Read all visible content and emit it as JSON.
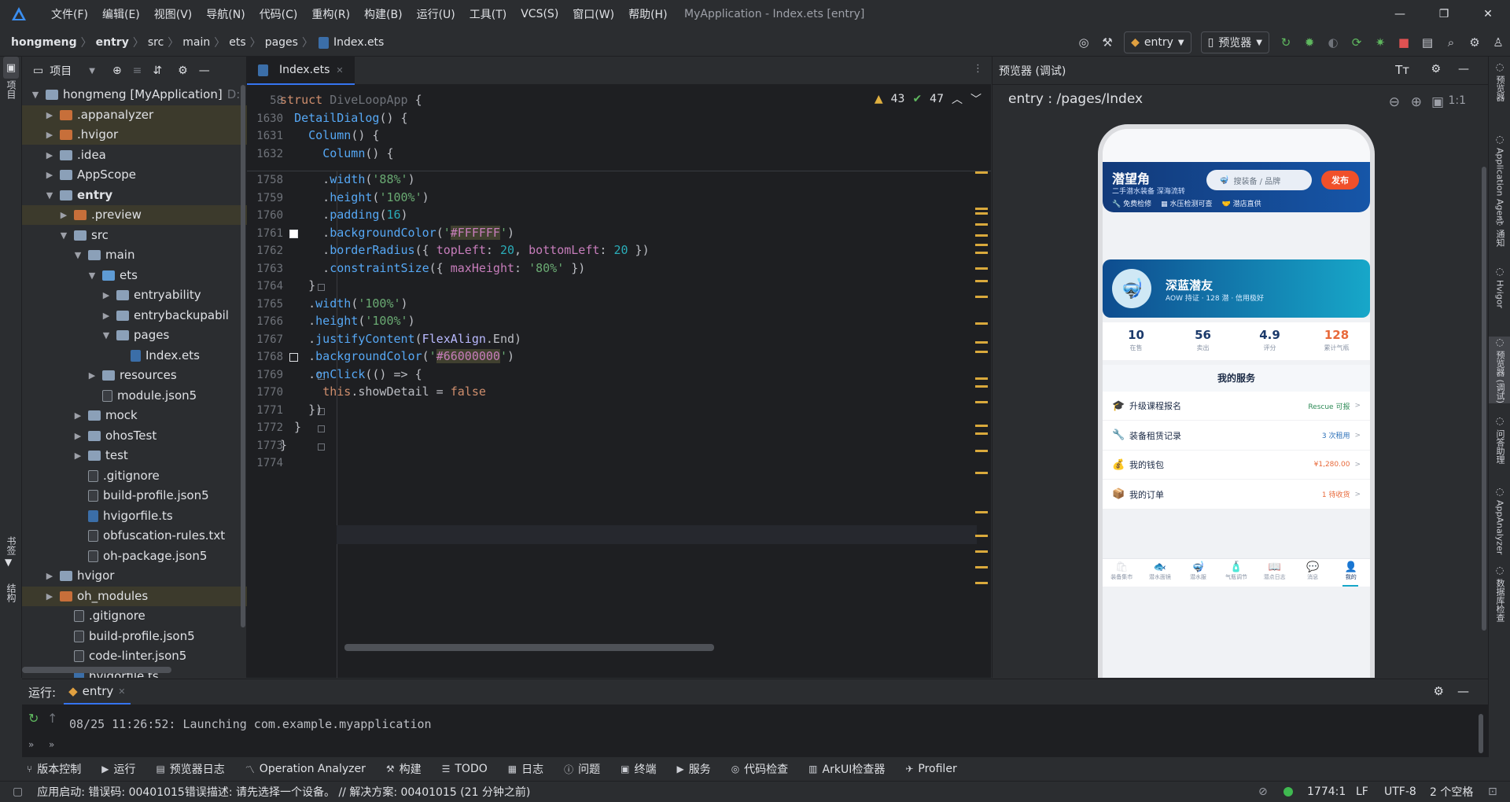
{
  "titlebar": {
    "menus": [
      "文件(F)",
      "编辑(E)",
      "视图(V)",
      "导航(N)",
      "代码(C)",
      "重构(R)",
      "构建(B)",
      "运行(U)",
      "工具(T)",
      "VCS(S)",
      "窗口(W)",
      "帮助(H)"
    ],
    "title": "MyApplication - Index.ets [entry]"
  },
  "navbar": {
    "crumbs": [
      "hongmeng",
      "entry",
      "src",
      "main",
      "ets",
      "pages",
      "Index.ets"
    ],
    "run_config": "entry",
    "device": "预览器"
  },
  "project": {
    "title": "项目",
    "tree": [
      {
        "label": "hongmeng [MyApplication]",
        "suffix": "D:",
        "depth": 0,
        "open": true,
        "kind": "folder"
      },
      {
        "label": ".appanalyzer",
        "depth": 1,
        "kind": "folder-or",
        "hl": true
      },
      {
        "label": ".hvigor",
        "depth": 1,
        "kind": "folder-or",
        "hl": true
      },
      {
        "label": ".idea",
        "depth": 1,
        "kind": "folder"
      },
      {
        "label": "AppScope",
        "depth": 1,
        "kind": "folder"
      },
      {
        "label": "entry",
        "depth": 1,
        "open": true,
        "kind": "folder",
        "bold": true
      },
      {
        "label": ".preview",
        "depth": 2,
        "kind": "folder-or",
        "hl": true
      },
      {
        "label": "src",
        "depth": 2,
        "open": true,
        "kind": "folder"
      },
      {
        "label": "main",
        "depth": 3,
        "open": true,
        "kind": "folder"
      },
      {
        "label": "ets",
        "depth": 4,
        "open": true,
        "kind": "folder-bl"
      },
      {
        "label": "entryability",
        "depth": 5,
        "kind": "folder"
      },
      {
        "label": "entrybackupabil",
        "depth": 5,
        "kind": "folder"
      },
      {
        "label": "pages",
        "depth": 5,
        "open": true,
        "kind": "folder"
      },
      {
        "label": "Index.ets",
        "depth": 6,
        "kind": "file-ts",
        "leaf": true
      },
      {
        "label": "resources",
        "depth": 4,
        "kind": "folder"
      },
      {
        "label": "module.json5",
        "depth": 4,
        "kind": "file",
        "leaf": true
      },
      {
        "label": "mock",
        "depth": 3,
        "kind": "folder"
      },
      {
        "label": "ohosTest",
        "depth": 3,
        "kind": "folder"
      },
      {
        "label": "test",
        "depth": 3,
        "kind": "folder"
      },
      {
        "label": ".gitignore",
        "depth": 3,
        "kind": "file",
        "leaf": true
      },
      {
        "label": "build-profile.json5",
        "depth": 3,
        "kind": "file",
        "leaf": true
      },
      {
        "label": "hvigorfile.ts",
        "depth": 3,
        "kind": "file-ts",
        "leaf": true
      },
      {
        "label": "obfuscation-rules.txt",
        "depth": 3,
        "kind": "file",
        "leaf": true
      },
      {
        "label": "oh-package.json5",
        "depth": 3,
        "kind": "file",
        "leaf": true
      },
      {
        "label": "hvigor",
        "depth": 1,
        "kind": "folder"
      },
      {
        "label": "oh_modules",
        "depth": 1,
        "kind": "folder-or",
        "hl": true
      },
      {
        "label": ".gitignore",
        "depth": 2,
        "kind": "file",
        "leaf": true
      },
      {
        "label": "build-profile.json5",
        "depth": 2,
        "kind": "file",
        "leaf": true
      },
      {
        "label": "code-linter.json5",
        "depth": 2,
        "kind": "file",
        "leaf": true
      },
      {
        "label": "hvigorfile.ts",
        "depth": 2,
        "kind": "file-ts",
        "leaf": true
      }
    ]
  },
  "editor": {
    "tab": "Index.ets",
    "warnings": "43",
    "checks": "47",
    "sticky": [
      {
        "ln": "58",
        "code": "struct DiveLoopApp {"
      },
      {
        "ln": "1630",
        "code": "  DetailDialog() {"
      },
      {
        "ln": "1631",
        "code": "    Column() {"
      },
      {
        "ln": "1632",
        "code": "      Column() {"
      }
    ],
    "lines": [
      {
        "ln": "1758",
        "code": "      .width('88%')"
      },
      {
        "ln": "1759",
        "code": "      .height('100%')"
      },
      {
        "ln": "1760",
        "code": "      .padding(16)"
      },
      {
        "ln": "1761",
        "code": "      .backgroundColor('#FFFFFF')"
      },
      {
        "ln": "1762",
        "code": "      .borderRadius({ topLeft: 20, bottomLeft: 20 })"
      },
      {
        "ln": "1763",
        "code": "      .constraintSize({ maxHeight: '80%' })"
      },
      {
        "ln": "1764",
        "code": "    }"
      },
      {
        "ln": "1765",
        "code": "    .width('100%')"
      },
      {
        "ln": "1766",
        "code": "    .height('100%')"
      },
      {
        "ln": "1767",
        "code": "    .justifyContent(FlexAlign.End)"
      },
      {
        "ln": "1768",
        "code": "    .backgroundColor('#66000000')"
      },
      {
        "ln": "1769",
        "code": "    .onClick(() => {"
      },
      {
        "ln": "1770",
        "code": "      this.showDetail = false"
      },
      {
        "ln": "1771",
        "code": "    })"
      },
      {
        "ln": "1772",
        "code": "  }"
      },
      {
        "ln": "1773",
        "code": "}"
      },
      {
        "ln": "1774",
        "code": ""
      }
    ]
  },
  "preview": {
    "title": "预览器 (调试)",
    "route": "entry : /pages/Index",
    "zoom": "1:1",
    "app": {
      "brand": "潜望角",
      "tagline": "二手潜水装备 深海流转",
      "search_placeholder": "搜装备 / 品牌",
      "publish": "发布",
      "badges": [
        "免费检修",
        "水压检测可查",
        "潜店直供"
      ],
      "profile": {
        "name": "深蓝潜友",
        "desc": "AOW 持证 · 128 潜 · 信用极好"
      },
      "stats": [
        {
          "value": "10",
          "label": "在售",
          "color": "#1b3a6b"
        },
        {
          "value": "56",
          "label": "卖出",
          "color": "#1b3a6b"
        },
        {
          "value": "4.9",
          "label": "评分",
          "color": "#1b3a6b"
        },
        {
          "value": "128",
          "label": "累计气瓶",
          "color": "#e8693a"
        }
      ],
      "services_title": "我的服务",
      "services": [
        {
          "icon": "🎓",
          "label": "升级课程报名",
          "value": "Rescue 可报",
          "color": "#2e8b57"
        },
        {
          "icon": "🔧",
          "label": "装备租赁记录",
          "value": "3 次租用",
          "color": "#2a6fb8"
        },
        {
          "icon": "💰",
          "label": "我的钱包",
          "value": "¥1,280.00",
          "color": "#e8693a"
        },
        {
          "icon": "📦",
          "label": "我的订单",
          "value": "1 待收货",
          "color": "#e8693a"
        }
      ],
      "tabs": [
        {
          "icon": "🛍",
          "label": "装备集市"
        },
        {
          "icon": "🐟",
          "label": "潜水面镜"
        },
        {
          "icon": "🤿",
          "label": "潜水服"
        },
        {
          "icon": "🧴",
          "label": "气瓶调节"
        },
        {
          "icon": "📖",
          "label": "潜点日志"
        },
        {
          "icon": "💬",
          "label": "消息"
        },
        {
          "icon": "👤",
          "label": "我的"
        }
      ]
    }
  },
  "run": {
    "label": "运行:",
    "config": "entry",
    "log": "08/25 11:26:52: Launching com.example.myapplication"
  },
  "bottomtools": [
    "版本控制",
    "运行",
    "预览器日志",
    "Operation Analyzer",
    "构建",
    "TODO",
    "日志",
    "问题",
    "终端",
    "服务",
    "代码检查",
    "ArkUI检查器",
    "Profiler"
  ],
  "status": {
    "message": "应用启动: 错误码: 00401015错误描述: 请先选择一个设备。 // 解决方案: 00401015 (21 分钟之前)",
    "position": "1774:1",
    "line_sep": "LF",
    "encoding": "UTF-8",
    "indent": "2 个空格"
  },
  "leftstrip": {
    "top": "项目",
    "bottom1": "书签",
    "bottom2": "结构"
  },
  "rightstrip": [
    "预览器",
    "Application Agent",
    "通知",
    "Hvigor",
    "预览器 (调试)",
    "问答助理",
    "AppAnalyzer",
    "数据库检查"
  ]
}
